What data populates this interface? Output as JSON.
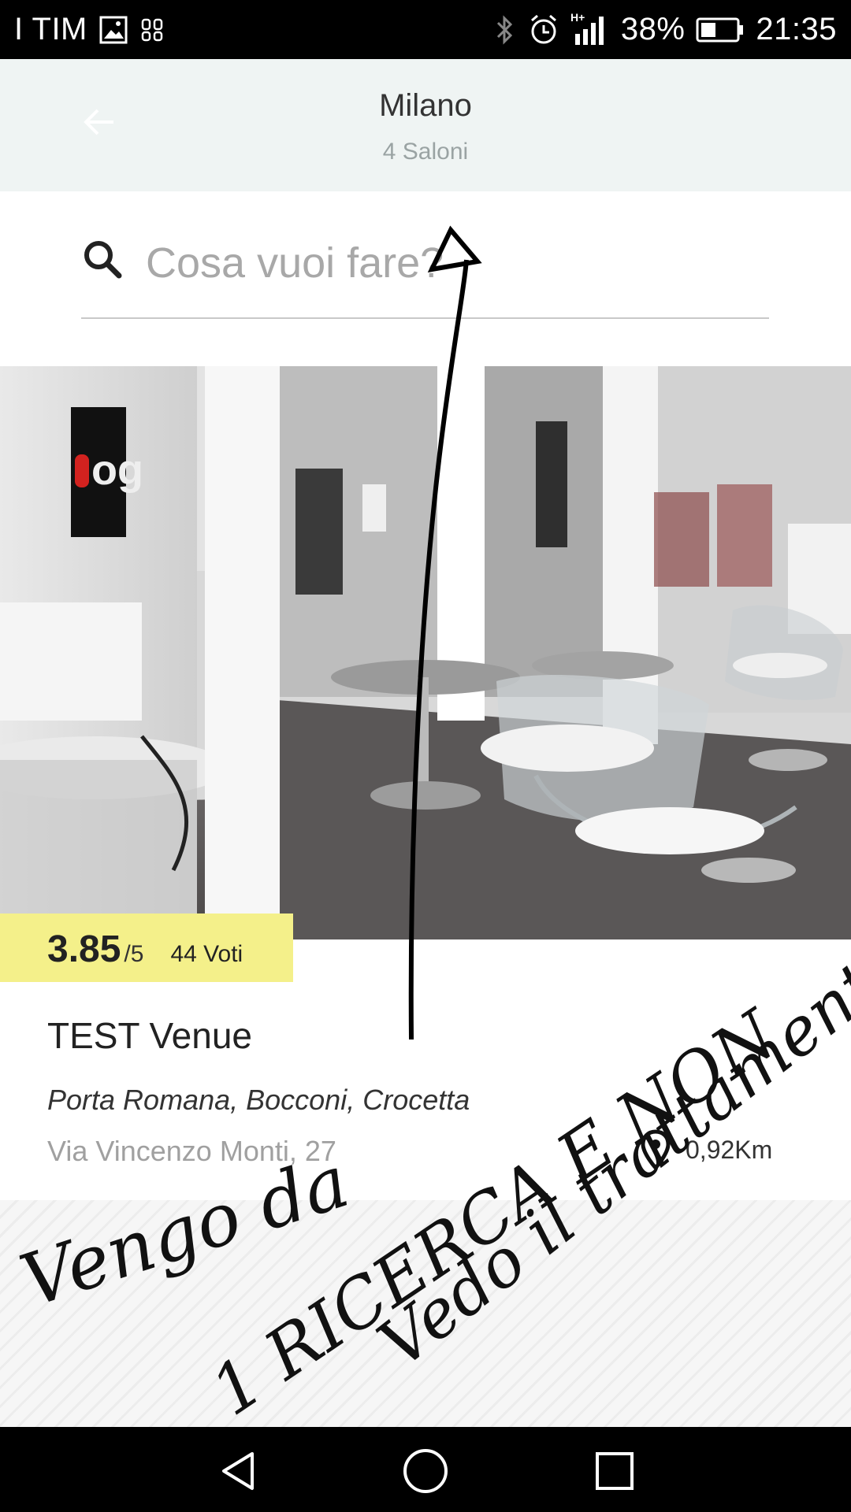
{
  "status_bar": {
    "carrier": "I TIM",
    "network": "H+",
    "battery": "38%",
    "time": "21:35",
    "icons": [
      "image-icon",
      "notification-icon",
      "bluetooth-icon",
      "alarm-icon",
      "signal-icon",
      "battery-icon"
    ]
  },
  "header": {
    "title": "Milano",
    "subtitle": "4 Saloni",
    "back_icon": "arrow-left-icon"
  },
  "search": {
    "placeholder": "Cosa vuoi fare?",
    "value": "",
    "icon": "search-icon"
  },
  "venue": {
    "rating": "3.85",
    "rating_scale": "/5",
    "votes": "44 Voti",
    "name": "TEST Venue",
    "area": "Porta Romana, Bocconi, Crocetta",
    "address": "Via Vincenzo Monti, 27",
    "distance": "0,92Km",
    "logo_text": "og",
    "colors": {
      "rating_bg": "#f4f08a",
      "header_bg": "#eff4f3"
    }
  },
  "annotation": {
    "line1": "Vengo da",
    "line2": "1 RICERCA E NON",
    "line3": "Vedo il trattamento"
  },
  "nav_bar": {
    "buttons": [
      "back-triangle-icon",
      "home-circle-icon",
      "recents-square-icon"
    ]
  }
}
